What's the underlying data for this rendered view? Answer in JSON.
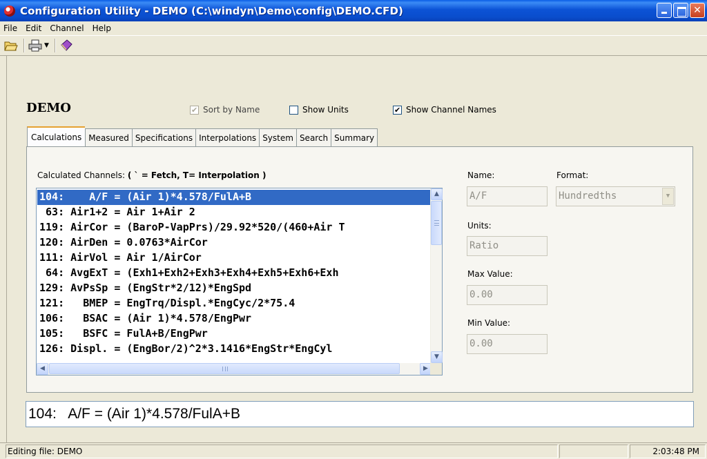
{
  "window": {
    "title": "Configuration Utility - DEMO  (C:\\windyn\\Demo\\config\\DEMO.CFD)"
  },
  "menu": [
    {
      "label": "File"
    },
    {
      "label": "Edit"
    },
    {
      "label": "Channel"
    },
    {
      "label": "Help"
    }
  ],
  "toolbar": {
    "icons": [
      "open-folder-icon",
      "print-icon",
      "dropdown-arrow-icon",
      "help-book-icon"
    ]
  },
  "document": {
    "name": "DEMO"
  },
  "options": {
    "sort_by_name": {
      "label": "Sort by Name",
      "checked": true,
      "enabled": false
    },
    "show_units": {
      "label": "Show Units",
      "checked": false
    },
    "show_channel_names": {
      "label": "Show Channel Names",
      "checked": true
    }
  },
  "tabs": [
    {
      "label": "Calculations",
      "active": true
    },
    {
      "label": "Measured"
    },
    {
      "label": "Specifications"
    },
    {
      "label": "Interpolations"
    },
    {
      "label": "System"
    },
    {
      "label": "Search"
    },
    {
      "label": "Summary"
    }
  ],
  "calculations": {
    "list_label": "Calculated Channels: ",
    "list_label_hint": "( ` = Fetch, T= Interpolation )",
    "channels": [
      "104:    A/F = (Air 1)*4.578/FulA+B",
      " 63: Air1+2 = Air 1+Air 2",
      "119: AirCor = (BaroP-VapPrs)/29.92*520/(460+Air T",
      "120: AirDen = 0.0763*AirCor",
      "111: AirVol = Air 1/AirCor",
      " 64: AvgExT = (Exh1+Exh2+Exh3+Exh4+Exh5+Exh6+Exh",
      "129: AvPsSp = (EngStr*2/12)*EngSpd",
      "121:   BMEP = EngTrq/Displ.*EngCyc/2*75.4",
      "106:   BSAC = (Air 1)*4.578/EngPwr",
      "105:   BSFC = FulA+B/EngPwr",
      "126: Displ. = (EngBor/2)^2*3.1416*EngStr*EngCyl"
    ],
    "selected_index": 0,
    "name_label": "Name:",
    "name_value": "A/F",
    "format_label": "Format:",
    "format_value": "Hundredths",
    "units_label": "Units:",
    "units_value": "Ratio",
    "max_label": "Max Value:",
    "max_value": "0.00",
    "min_label": "Min Value:",
    "min_value": "0.00",
    "edit_line": "104:   A/F = (Air 1)*4.578/FulA+B"
  },
  "status": {
    "message": "Editing file: DEMO",
    "time": "2:03:48 PM"
  }
}
